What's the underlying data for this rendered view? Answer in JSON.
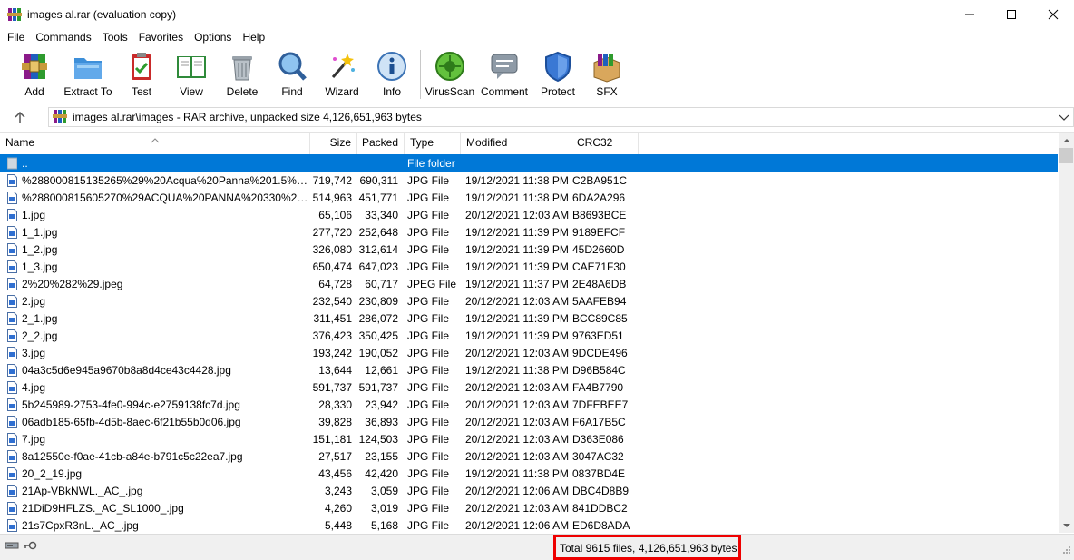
{
  "window": {
    "title": "images al.rar (evaluation copy)",
    "controls": [
      "minimize-icon",
      "maximize-icon",
      "close-icon"
    ]
  },
  "menu": [
    "File",
    "Commands",
    "Tools",
    "Favorites",
    "Options",
    "Help"
  ],
  "toolbar": [
    {
      "label": "Add",
      "icon": "add-archive-icon"
    },
    {
      "label": "Extract To",
      "icon": "extract-folder-icon"
    },
    {
      "label": "Test",
      "icon": "test-clipboard-icon"
    },
    {
      "label": "View",
      "icon": "view-book-icon"
    },
    {
      "label": "Delete",
      "icon": "trash-icon"
    },
    {
      "label": "Find",
      "icon": "magnifier-icon"
    },
    {
      "label": "Wizard",
      "icon": "wizard-wand-icon"
    },
    {
      "label": "Info",
      "icon": "info-icon"
    },
    {
      "label": "VirusScan",
      "icon": "virus-scan-icon"
    },
    {
      "label": "Comment",
      "icon": "comment-icon"
    },
    {
      "label": "Protect",
      "icon": "shield-icon"
    },
    {
      "label": "SFX",
      "icon": "sfx-box-icon"
    }
  ],
  "address": {
    "path": "images al.rar\\images - RAR archive, unpacked size 4,126,651,963 bytes"
  },
  "columns": {
    "name": "Name",
    "size": "Size",
    "packed": "Packed",
    "type": "Type",
    "modified": "Modified",
    "crc": "CRC32"
  },
  "files": [
    {
      "name": "..",
      "size": "",
      "packed": "",
      "type": "File folder",
      "modified": "",
      "crc": "",
      "selected": true
    },
    {
      "name": "%288000815135265%29%20Acqua%20Panna%201.5%20Lit...",
      "size": "719,742",
      "packed": "690,311",
      "type": "JPG File",
      "modified": "19/12/2021 11:38 PM",
      "crc": "C2BA951C"
    },
    {
      "name": "%288000815605270%29ACQUA%20PANNA%20330%20ml...",
      "size": "514,963",
      "packed": "451,771",
      "type": "JPG File",
      "modified": "19/12/2021 11:38 PM",
      "crc": "6DA2A296"
    },
    {
      "name": "1.jpg",
      "size": "65,106",
      "packed": "33,340",
      "type": "JPG File",
      "modified": "20/12/2021 12:03 AM",
      "crc": "B8693BCE"
    },
    {
      "name": "1_1.jpg",
      "size": "277,720",
      "packed": "252,648",
      "type": "JPG File",
      "modified": "19/12/2021 11:39 PM",
      "crc": "9189EFCF"
    },
    {
      "name": "1_2.jpg",
      "size": "326,080",
      "packed": "312,614",
      "type": "JPG File",
      "modified": "19/12/2021 11:39 PM",
      "crc": "45D2660D"
    },
    {
      "name": "1_3.jpg",
      "size": "650,474",
      "packed": "647,023",
      "type": "JPG File",
      "modified": "19/12/2021 11:39 PM",
      "crc": "CAE71F30"
    },
    {
      "name": "2%20%282%29.jpeg",
      "size": "64,728",
      "packed": "60,717",
      "type": "JPEG File",
      "modified": "19/12/2021 11:37 PM",
      "crc": "2E48A6DB"
    },
    {
      "name": "2.jpg",
      "size": "232,540",
      "packed": "230,809",
      "type": "JPG File",
      "modified": "20/12/2021 12:03 AM",
      "crc": "5AAFEB94"
    },
    {
      "name": "2_1.jpg",
      "size": "311,451",
      "packed": "286,072",
      "type": "JPG File",
      "modified": "19/12/2021 11:39 PM",
      "crc": "BCC89C85"
    },
    {
      "name": "2_2.jpg",
      "size": "376,423",
      "packed": "350,425",
      "type": "JPG File",
      "modified": "19/12/2021 11:39 PM",
      "crc": "9763ED51"
    },
    {
      "name": "3.jpg",
      "size": "193,242",
      "packed": "190,052",
      "type": "JPG File",
      "modified": "20/12/2021 12:03 AM",
      "crc": "9DCDE496"
    },
    {
      "name": "04a3c5d6e945a9670b8a8d4ce43c4428.jpg",
      "size": "13,644",
      "packed": "12,661",
      "type": "JPG File",
      "modified": "19/12/2021 11:38 PM",
      "crc": "D96B584C"
    },
    {
      "name": "4.jpg",
      "size": "591,737",
      "packed": "591,737",
      "type": "JPG File",
      "modified": "20/12/2021 12:03 AM",
      "crc": "FA4B7790"
    },
    {
      "name": "5b245989-2753-4fe0-994c-e2759138fc7d.jpg",
      "size": "28,330",
      "packed": "23,942",
      "type": "JPG File",
      "modified": "20/12/2021 12:03 AM",
      "crc": "7DFEBEE7"
    },
    {
      "name": "06adb185-65fb-4d5b-8aec-6f21b55b0d06.jpg",
      "size": "39,828",
      "packed": "36,893",
      "type": "JPG File",
      "modified": "20/12/2021 12:03 AM",
      "crc": "F6A17B5C"
    },
    {
      "name": "7.jpg",
      "size": "151,181",
      "packed": "124,503",
      "type": "JPG File",
      "modified": "20/12/2021 12:03 AM",
      "crc": "D363E086"
    },
    {
      "name": "8a12550e-f0ae-41cb-a84e-b791c5c22ea7.jpg",
      "size": "27,517",
      "packed": "23,155",
      "type": "JPG File",
      "modified": "20/12/2021 12:03 AM",
      "crc": "3047AC32"
    },
    {
      "name": "20_2_19.jpg",
      "size": "43,456",
      "packed": "42,420",
      "type": "JPG File",
      "modified": "19/12/2021 11:38 PM",
      "crc": "0837BD4E"
    },
    {
      "name": "21Ap-VBkNWL._AC_.jpg",
      "size": "3,243",
      "packed": "3,059",
      "type": "JPG File",
      "modified": "20/12/2021 12:06 AM",
      "crc": "DBC4D8B9"
    },
    {
      "name": "21DiD9HFLZS._AC_SL1000_.jpg",
      "size": "4,260",
      "packed": "3,019",
      "type": "JPG File",
      "modified": "20/12/2021 12:03 AM",
      "crc": "841DDBC2"
    },
    {
      "name": "21s7CpxR3nL._AC_.jpg",
      "size": "5,448",
      "packed": "5,168",
      "type": "JPG File",
      "modified": "20/12/2021 12:06 AM",
      "crc": "ED6D8ADA"
    }
  ],
  "status": {
    "text": "Total 9615 files, 4,126,651,963 bytes"
  },
  "colors": {
    "selection": "#0078d7",
    "highlight_box": "#ee0000"
  }
}
